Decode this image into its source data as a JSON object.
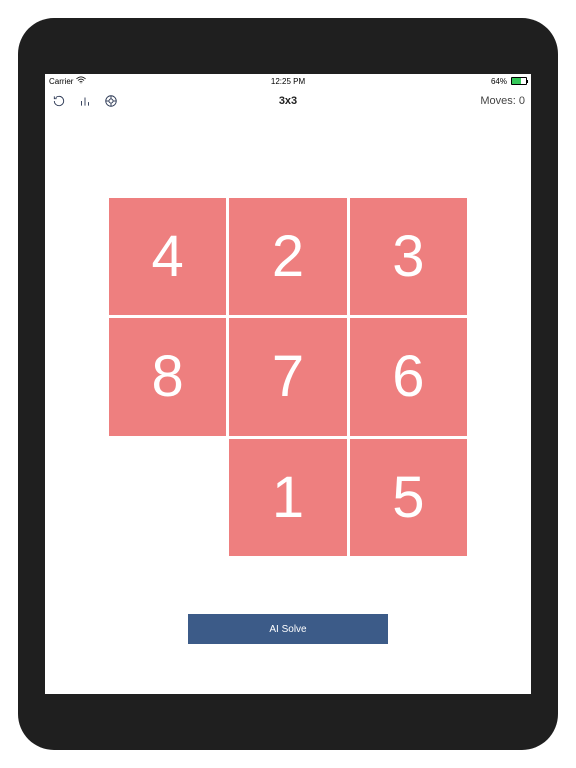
{
  "statusbar": {
    "carrier": "Carrier",
    "time": "12:25 PM",
    "battery": "64%"
  },
  "nav": {
    "title": "3x3",
    "moves_label": "Moves: ",
    "moves_value": "0"
  },
  "board": {
    "grid_size": 3,
    "empty_index": 6,
    "tile_color": "#ee7f7f",
    "tiles": [
      "4",
      "2",
      "3",
      "8",
      "7",
      "6",
      "",
      "1",
      "5"
    ]
  },
  "buttons": {
    "ai_solve": "AI Solve"
  }
}
